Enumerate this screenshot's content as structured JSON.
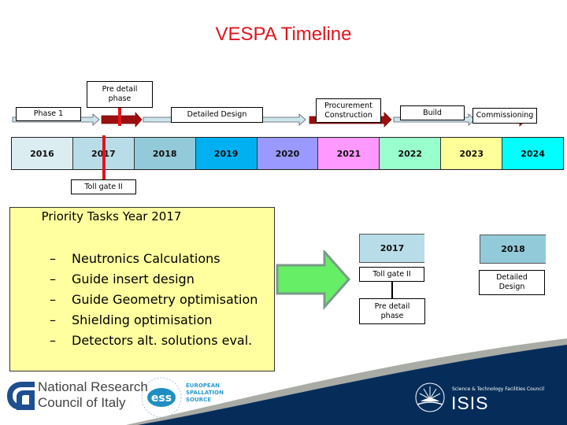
{
  "title": "VESPA Timeline",
  "timeline": {
    "phases": [
      {
        "label": "Phase 1",
        "arrow": "light"
      },
      {
        "label": "Pre detail phase",
        "arrow": "dark-red"
      },
      {
        "label": "Detailed Design",
        "arrow": "light"
      },
      {
        "label": "Procurement Construction",
        "arrow": "dark-red"
      },
      {
        "label": "Build",
        "arrow": "light"
      },
      {
        "label": "Commissioning",
        "arrow": "dark-red"
      }
    ],
    "years": [
      {
        "label": "2016",
        "color": "#dcedf2"
      },
      {
        "label": "2017",
        "color": "#b9dde8"
      },
      {
        "label": "2018",
        "color": "#93cad9"
      },
      {
        "label": "2019",
        "color": "#00b0f0"
      },
      {
        "label": "2020",
        "color": "#9999ff"
      },
      {
        "label": "2021",
        "color": "#ff99ff"
      },
      {
        "label": "2022",
        "color": "#99ffcc"
      },
      {
        "label": "2023",
        "color": "#ffff99"
      },
      {
        "label": "2024",
        "color": "#00ffff"
      }
    ],
    "milestone": "Toll gate II"
  },
  "priority": {
    "title": "Priority Tasks Year 2017",
    "tasks": [
      "Neutronics Calculations",
      "Guide insert design",
      "Guide Geometry optimisation",
      "Shielding optimisation",
      "Detectors alt. solutions eval."
    ]
  },
  "detail": {
    "col1": {
      "year": "2017",
      "top": "Toll gate II",
      "bottom": "Pre detail phase"
    },
    "col2": {
      "year": "2018",
      "label": "Detailed Design"
    }
  },
  "logos": {
    "cnr_line1": "National Research",
    "cnr_line2": "Council of Italy",
    "ess_mark": "ess",
    "ess_line1": "EUROPEAN",
    "ess_line2": "SPALLATION",
    "ess_line3": "SOURCE",
    "stfc": "Science & Technology Facilities Council",
    "isis": "ISIS"
  },
  "colors": {
    "title": "#e0141c",
    "dark_arrow": "#9c0f0f",
    "light_arrow": "#cde6ec",
    "panel": "#ffffa0",
    "green_arrow": "#66ee66",
    "footer_navy": "#062d5a"
  }
}
